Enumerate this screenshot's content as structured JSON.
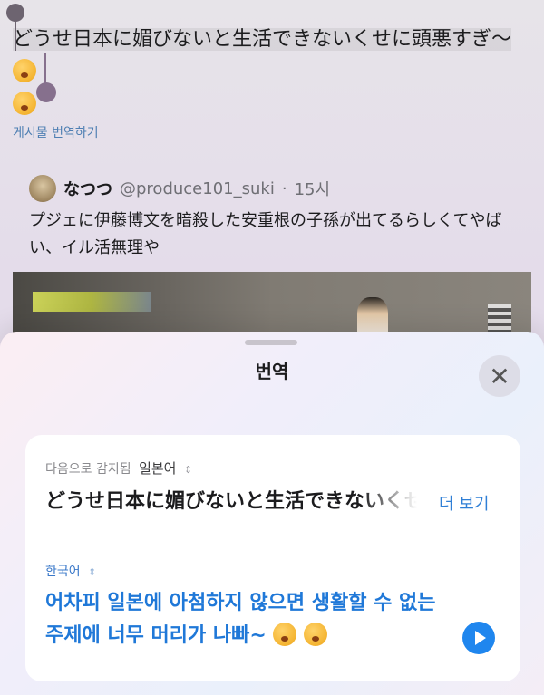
{
  "post": {
    "selected_text": "どうせ日本に媚びないと生活できないくせに頭悪すぎ～",
    "translate_link": "게시물 번역하기"
  },
  "quote": {
    "name": "なつつ",
    "handle": "@produce101_suki",
    "time": "15시",
    "text": "プジェに伊藤博文を暗殺した安重根の子孫が出てるらしくてやばい、イル活無理や"
  },
  "sheet": {
    "title": "번역",
    "close_icon": "close-icon",
    "source": {
      "detected_label": "다음으로 감지됨",
      "language": "일본어",
      "text": "どうせ日本に媚びないと生活できないくせに頭悪すぎ～",
      "see_more": "더 보기"
    },
    "target": {
      "language": "한국어",
      "text": "어차피 일본에 아첨하지 않으면 생활할 수 없는 주제에 너무 머리가 나빠~",
      "play_icon": "play-icon"
    }
  },
  "colors": {
    "accent_blue": "#1f78d8",
    "link_blue": "#4f7fb3"
  }
}
